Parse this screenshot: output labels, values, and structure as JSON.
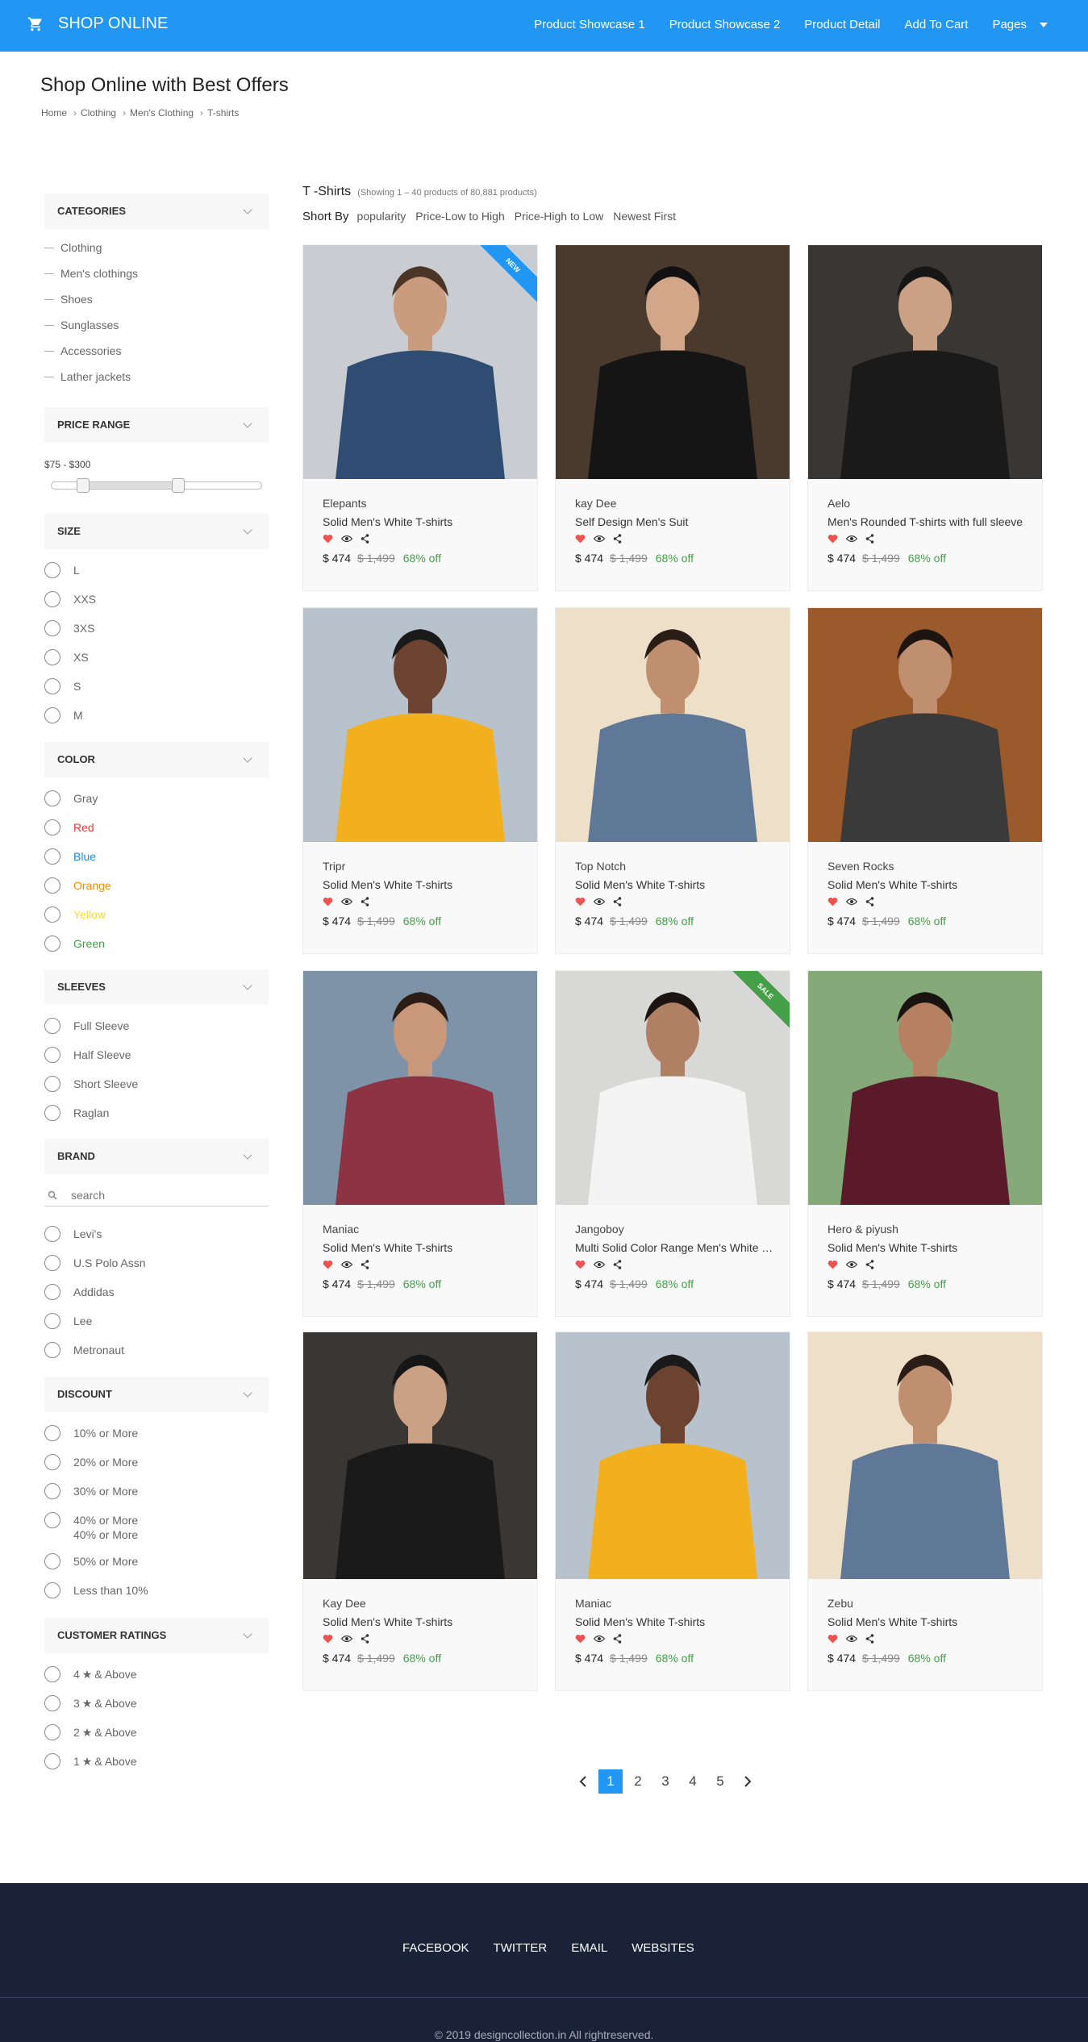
{
  "header": {
    "brand": "SHOP ONLINE",
    "nav": [
      "Product Showcase 1",
      "Product Showcase 2",
      "Product Detail",
      "Add To Cart",
      "Pages"
    ]
  },
  "page": {
    "title": "Shop Online with Best Offers",
    "breadcrumb": [
      "Home",
      "Clothing",
      "Men's Clothing",
      "T-shirts"
    ]
  },
  "sidebar": {
    "categories": {
      "title": "CATEGORIES",
      "items": [
        "Clothing",
        "Men's clothings",
        "Shoes",
        "Sunglasses",
        "Accessories",
        "Lather jackets"
      ]
    },
    "price": {
      "title": "PRICE RANGE",
      "range": "$75 - $300",
      "low": 0.15,
      "high": 0.6
    },
    "size": {
      "title": "SIZE",
      "items": [
        "L",
        "XXS",
        "3XS",
        "XS",
        "S",
        "M"
      ]
    },
    "color": {
      "title": "COLOR",
      "items": [
        {
          "label": "Gray",
          "color": "#666666"
        },
        {
          "label": "Red",
          "color": "#e53935"
        },
        {
          "label": "Blue",
          "color": "#1e88e5"
        },
        {
          "label": "Orange",
          "color": "#fb8c00"
        },
        {
          "label": "Yellow",
          "color": "#fdd835"
        },
        {
          "label": "Green",
          "color": "#43a047"
        }
      ]
    },
    "sleeves": {
      "title": "SLEEVES",
      "items": [
        "Full Sleeve",
        "Half Sleeve",
        "Short Sleeve",
        "Raglan"
      ]
    },
    "brand": {
      "title": "BRAND",
      "search_placeholder": "search",
      "items": [
        "Levi's",
        "U.S Polo Assn",
        "Addidas",
        "Lee",
        "Metronaut"
      ]
    },
    "discount": {
      "title": "DISCOUNT",
      "items": [
        "10% or More",
        "20% or More",
        "30% or More",
        "40% or More",
        "50% or More",
        "Less than 10%"
      ],
      "overlap_label": "40% or More"
    },
    "ratings": {
      "title": "CUSTOMER RATINGS",
      "items": [
        "4",
        "3",
        "2",
        "1"
      ],
      "suffix": "& Above"
    }
  },
  "listing": {
    "heading": "T -Shirts",
    "count": "(Showing 1 – 40 products of 80,881 products)",
    "sort_label": "Short By",
    "sort_options": [
      "popularity",
      "Price-Low to High",
      "Price-High to Low",
      "Newest First"
    ]
  },
  "products": [
    {
      "brand": "Elepants",
      "name": "Solid Men's White T-shirts",
      "price": "$ 474",
      "old": "$ 1,499",
      "off": "68% off",
      "ribbon": "NEW",
      "ribbon_color": "#2196f3",
      "tone": "#c9ccd0",
      "cloth": "#2f4d73",
      "skin": "#c99b7f",
      "hair": "#4a3526"
    },
    {
      "brand": "kay Dee",
      "name": "Self Design Men's Suit",
      "price": "$ 474",
      "old": "$ 1,499",
      "off": "68% off",
      "ribbon": "",
      "ribbon_color": "",
      "tone": "#4a3a2e",
      "cloth": "#151515",
      "skin": "#d2a688",
      "hair": "#111111"
    },
    {
      "brand": "Aelo",
      "name": "Men's Rounded T-shirts with full sleeve",
      "price": "$ 474",
      "old": "$ 1,499",
      "off": "68% off",
      "ribbon": "",
      "ribbon_color": "",
      "tone": "#3a3634",
      "cloth": "#1a1a1a",
      "skin": "#caa184",
      "hair": "#161616"
    },
    {
      "brand": "Tripr",
      "name": "Solid Men's White T-shirts",
      "price": "$ 474",
      "old": "$ 1,499",
      "off": "68% off",
      "ribbon": "",
      "ribbon_color": "",
      "tone": "#b7c2cc",
      "cloth": "#f2b01e",
      "skin": "#6b4330",
      "hair": "#1a1a1a"
    },
    {
      "brand": "Top Notch",
      "name": "Solid Men's White T-shirts",
      "price": "$ 474",
      "old": "$ 1,499",
      "off": "68% off",
      "ribbon": "",
      "ribbon_color": "",
      "tone": "#eedfc9",
      "cloth": "#5f7897",
      "skin": "#c08f70",
      "hair": "#2a1d16"
    },
    {
      "brand": "Seven Rocks",
      "name": "Solid Men's White T-shirts",
      "price": "$ 474",
      "old": "$ 1,499",
      "off": "68% off",
      "ribbon": "",
      "ribbon_color": "",
      "tone": "#9a5a2c",
      "cloth": "#3a3a3a",
      "skin": "#c08f70",
      "hair": "#1e1510"
    },
    {
      "brand": "Maniac",
      "name": "Solid Men's White T-shirts",
      "price": "$ 474",
      "old": "$ 1,499",
      "off": "68% off",
      "ribbon": "",
      "ribbon_color": "",
      "tone": "#7f93a8",
      "cloth": "#8e3344",
      "skin": "#c9977a",
      "hair": "#2b1d15"
    },
    {
      "brand": "Jangoboy",
      "name": "Multi Solid Color Range Men's White T-shirts",
      "price": "$ 474",
      "old": "$ 1,499",
      "off": "68% off",
      "ribbon": "SALE",
      "ribbon_color": "#43a047",
      "tone": "#d8d8d6",
      "cloth": "#f4f4f4",
      "skin": "#b08064",
      "hair": "#1c1410"
    },
    {
      "brand": "Hero & piyush",
      "name": "Solid Men's White T-shirts",
      "price": "$ 474",
      "old": "$ 1,499",
      "off": "68% off",
      "ribbon": "",
      "ribbon_color": "",
      "tone": "#86a97a",
      "cloth": "#5a1a2a",
      "skin": "#b68063",
      "hair": "#1a1410"
    },
    {
      "brand": "Kay Dee",
      "name": "Solid Men's White T-shirts",
      "price": "$ 474",
      "old": "$ 1,499",
      "off": "68% off",
      "ribbon": "",
      "ribbon_color": "",
      "tone": "#3a3634",
      "cloth": "#1a1a1a",
      "skin": "#caa184",
      "hair": "#161616"
    },
    {
      "brand": "Maniac",
      "name": "Solid Men's White T-shirts",
      "price": "$ 474",
      "old": "$ 1,499",
      "off": "68% off",
      "ribbon": "",
      "ribbon_color": "",
      "tone": "#b7c2cc",
      "cloth": "#f2b01e",
      "skin": "#6b4330",
      "hair": "#1a1a1a"
    },
    {
      "brand": "Zebu",
      "name": "Solid Men's White T-shirts",
      "price": "$ 474",
      "old": "$ 1,499",
      "off": "68% off",
      "ribbon": "",
      "ribbon_color": "",
      "tone": "#eedfc9",
      "cloth": "#5f7897",
      "skin": "#c08f70",
      "hair": "#2a1d16"
    }
  ],
  "pagination": {
    "pages": [
      "1",
      "2",
      "3",
      "4",
      "5"
    ],
    "active": "1"
  },
  "footer": {
    "links": [
      "FACEBOOK",
      "TWITTER",
      "EMAIL",
      "WEBSITES"
    ],
    "copyright": "© 2019 designcollection.in All rightreserved."
  }
}
